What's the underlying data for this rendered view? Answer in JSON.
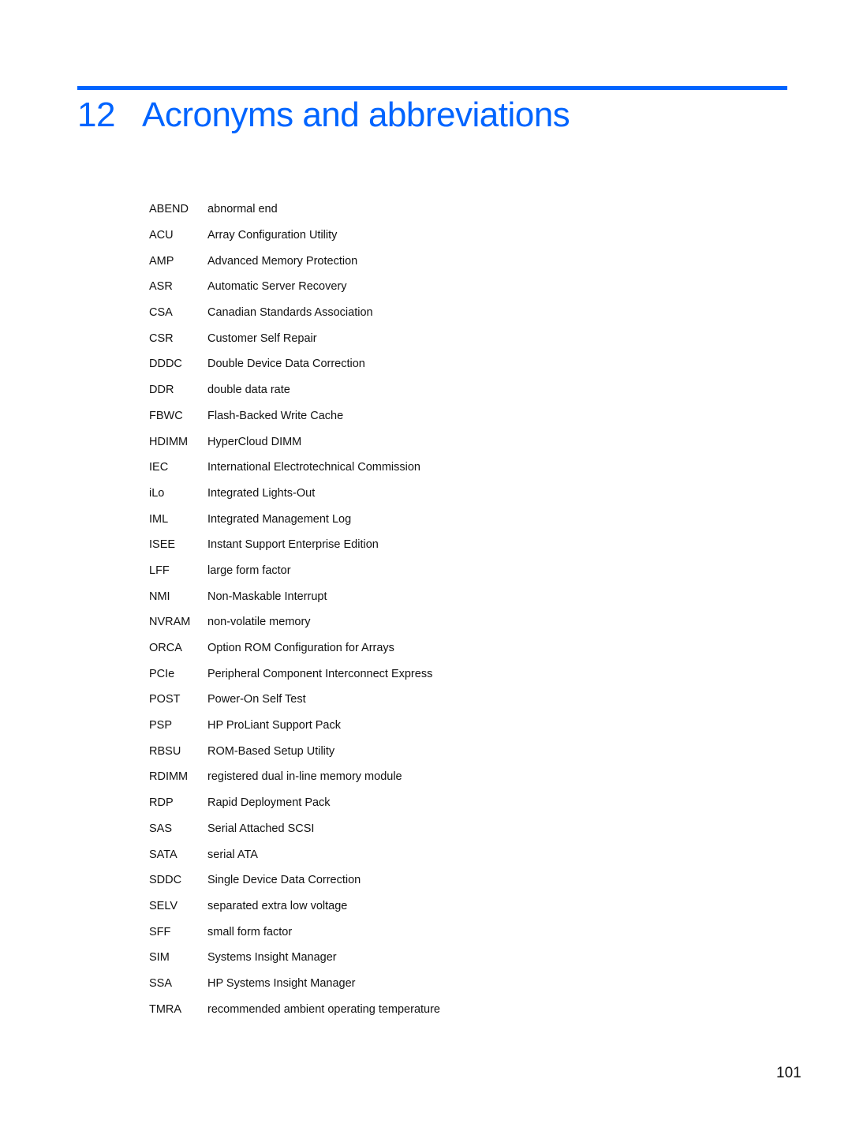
{
  "chapter": {
    "number": "12",
    "title": "Acronyms and abbreviations",
    "accent_color": "#0064ff"
  },
  "glossary": [
    {
      "term": "ABEND",
      "definition": "abnormal end"
    },
    {
      "term": "ACU",
      "definition": "Array Configuration Utility"
    },
    {
      "term": "AMP",
      "definition": "Advanced Memory Protection"
    },
    {
      "term": "ASR",
      "definition": "Automatic Server Recovery"
    },
    {
      "term": "CSA",
      "definition": "Canadian Standards Association"
    },
    {
      "term": "CSR",
      "definition": "Customer Self Repair"
    },
    {
      "term": "DDDC",
      "definition": "Double Device Data Correction"
    },
    {
      "term": "DDR",
      "definition": "double data rate"
    },
    {
      "term": "FBWC",
      "definition": "Flash-Backed Write Cache"
    },
    {
      "term": "HDIMM",
      "definition": "HyperCloud DIMM"
    },
    {
      "term": "IEC",
      "definition": "International Electrotechnical Commission"
    },
    {
      "term": "iLo",
      "definition": "Integrated Lights-Out"
    },
    {
      "term": "IML",
      "definition": "Integrated Management Log"
    },
    {
      "term": "ISEE",
      "definition": "Instant Support Enterprise Edition"
    },
    {
      "term": "LFF",
      "definition": "large form factor"
    },
    {
      "term": "NMI",
      "definition": "Non-Maskable Interrupt"
    },
    {
      "term": "NVRAM",
      "definition": "non-volatile memory"
    },
    {
      "term": "ORCA",
      "definition": "Option ROM Configuration for Arrays"
    },
    {
      "term": "PCIe",
      "definition": "Peripheral Component Interconnect Express"
    },
    {
      "term": "POST",
      "definition": "Power-On Self Test"
    },
    {
      "term": "PSP",
      "definition": "HP ProLiant Support Pack"
    },
    {
      "term": "RBSU",
      "definition": "ROM-Based Setup Utility"
    },
    {
      "term": "RDIMM",
      "definition": "registered dual in-line memory module"
    },
    {
      "term": "RDP",
      "definition": "Rapid Deployment Pack"
    },
    {
      "term": "SAS",
      "definition": "Serial Attached SCSI"
    },
    {
      "term": "SATA",
      "definition": "serial ATA"
    },
    {
      "term": "SDDC",
      "definition": "Single Device Data Correction"
    },
    {
      "term": "SELV",
      "definition": "separated extra low voltage"
    },
    {
      "term": "SFF",
      "definition": "small form factor"
    },
    {
      "term": "SIM",
      "definition": "Systems Insight Manager"
    },
    {
      "term": "SSA",
      "definition": "HP Systems Insight Manager"
    },
    {
      "term": "TMRA",
      "definition": "recommended ambient operating temperature"
    }
  ],
  "page_number": "101"
}
